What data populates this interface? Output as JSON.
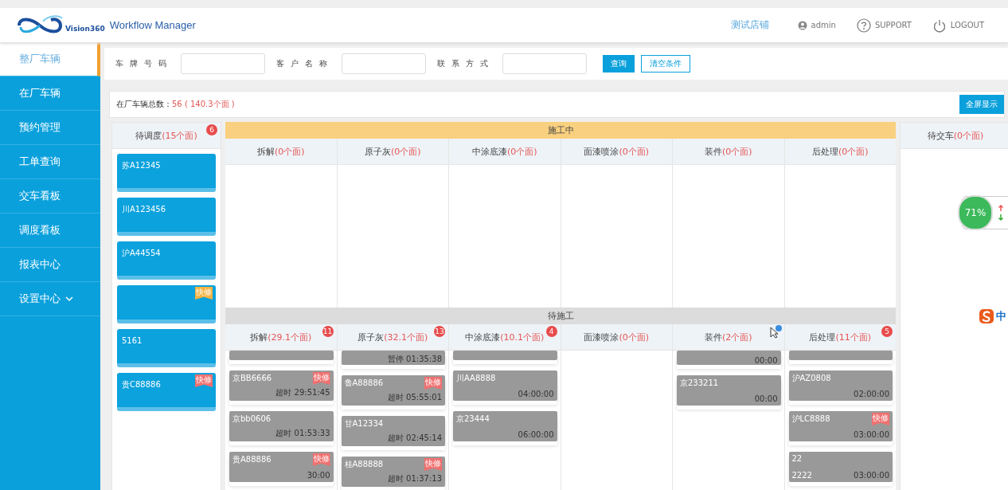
{
  "header": {
    "logo_text": "Vision360",
    "app_title": "Workflow Manager",
    "store": "测试店铺",
    "user": "admin",
    "support": "SUPPORT",
    "logout": "LOGOUT"
  },
  "sidebar": {
    "items": [
      {
        "label": "整厂车辆",
        "selected": true,
        "kind": "plain"
      },
      {
        "label": "在厂车辆",
        "selected": false,
        "kind": "plain"
      },
      {
        "label": "预约管理",
        "selected": false,
        "kind": "plain"
      },
      {
        "label": "工单查询",
        "selected": false,
        "kind": "plain"
      },
      {
        "label": "交车看板",
        "selected": false,
        "kind": "plain"
      },
      {
        "label": "调度看板",
        "selected": false,
        "kind": "plain"
      },
      {
        "label": "报表中心",
        "selected": false,
        "kind": "plain"
      },
      {
        "label": "设置中心",
        "selected": false,
        "kind": "submenu"
      }
    ]
  },
  "filters": {
    "fields": [
      {
        "label": "车牌号码"
      },
      {
        "label": "客户名称"
      },
      {
        "label": "联系方式"
      }
    ],
    "buttons": [
      {
        "label": "查询",
        "kind": "primary"
      },
      {
        "label": "清空条件",
        "kind": "outline"
      }
    ]
  },
  "summary": {
    "label": "在厂车辆总数：",
    "value": "56 ( 140.3个面 )",
    "button": "全屏显示"
  },
  "dispatch": {
    "title": "待调度",
    "count": "(15个面)",
    "badge": "6",
    "cards": [
      {
        "plate": "苏A12345"
      },
      {
        "plate": "川A123456"
      },
      {
        "plate": "沪A44554"
      },
      {
        "flag": {
          "label": "快修",
          "color": "#f5b342"
        }
      },
      {
        "plate": "5161"
      },
      {
        "plate": "贵C88886",
        "flag": {
          "label": "快修",
          "color": "#f07070"
        }
      }
    ]
  },
  "in_progress": {
    "title": "施工中",
    "columns": [
      {
        "name": "拆解",
        "count": "(0个面)"
      },
      {
        "name": "原子灰",
        "count": "(0个面)"
      },
      {
        "name": "中涂底漆",
        "count": "(0个面)"
      },
      {
        "name": "面漆喷涂",
        "count": "(0个面)"
      },
      {
        "name": "装件",
        "count": "(0个面)"
      },
      {
        "name": "后处理",
        "count": "(0个面)"
      }
    ]
  },
  "waiting": {
    "title": "待施工",
    "columns": [
      {
        "name": "拆解",
        "count": "(29.1个面)",
        "badge": "11",
        "cards": [
          {
            "partial": true
          },
          {
            "partial": false,
            "plate": "京BB6666",
            "flag": "快修",
            "status": "超时",
            "time": "29:51:45"
          },
          {
            "partial": false,
            "plate": "京bb0606",
            "status": "超时",
            "time": "01:53:33"
          },
          {
            "partial": false,
            "plate": "贵A88886",
            "flag": "快修",
            "time": "30:00"
          }
        ]
      },
      {
        "name": "原子灰",
        "count": "(32.1个面)",
        "badge": "13",
        "cards": [
          {
            "partial": true,
            "status": "暂停",
            "time": "01:35:38"
          },
          {
            "partial": false,
            "plate": "鲁A88886",
            "flag": "快修",
            "status": "超时",
            "time": "05:55:01"
          },
          {
            "partial": false,
            "plate": "甘A12334",
            "status": "超时",
            "time": "02:45:14"
          },
          {
            "partial": false,
            "plate": "桂A88888",
            "flag": "快修",
            "status": "超时",
            "time": "01:37:13"
          }
        ]
      },
      {
        "name": "中涂底漆",
        "count": "(10.1个面)",
        "badge": "4",
        "cards": [
          {
            "partial": true
          },
          {
            "partial": false,
            "plate": "川AA8888",
            "time": "04:00:00"
          },
          {
            "partial": false,
            "plate": "京23444",
            "time": "06:00:00"
          }
        ]
      },
      {
        "name": "面漆喷涂",
        "count": "(0个面)"
      },
      {
        "name": "装件",
        "count": "(2个面)",
        "pointer": true,
        "cards": [
          {
            "partial": true,
            "time": "00:00"
          },
          {
            "partial": false,
            "plate": "京233211",
            "time": "00:00"
          }
        ]
      },
      {
        "name": "后处理",
        "count": "(11个面)",
        "badge": "5",
        "cards": [
          {
            "partial": true
          },
          {
            "partial": false,
            "plate": "沪AZ0808",
            "time": "02:00:00"
          },
          {
            "partial": false,
            "plate": "沪LC8888",
            "flag": "快修",
            "time": "03:00:00"
          },
          {
            "partial": false,
            "plate": "22",
            "note": "2222",
            "time": "03:00:00"
          }
        ]
      }
    ]
  },
  "delivery": {
    "title": "待交车",
    "count": "(0个面)"
  },
  "widgets": {
    "meter": "71%",
    "ime": "中"
  }
}
